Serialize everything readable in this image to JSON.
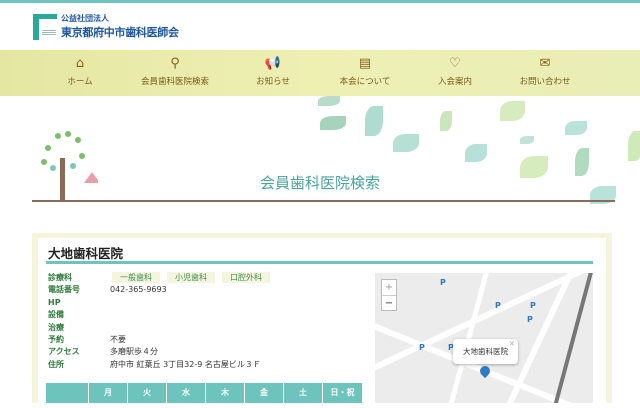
{
  "logo": {
    "sub": "公益社団法人",
    "main": "東京都府中市歯科医師会"
  },
  "nav": [
    {
      "label": "ホーム",
      "icon": "home-icon"
    },
    {
      "label": "会員歯科医院検索",
      "icon": "search-icon"
    },
    {
      "label": "お知らせ",
      "icon": "megaphone-icon"
    },
    {
      "label": "本会について",
      "icon": "clipboard-icon"
    },
    {
      "label": "入会案内",
      "icon": "heart-icon"
    },
    {
      "label": "お問い合わせ",
      "icon": "mail-icon"
    }
  ],
  "page_title": "会員歯科医院検索",
  "clinic": {
    "name": "大地歯科医院",
    "labels": {
      "dept": "診療科",
      "phone": "電話番号",
      "hp": "HP",
      "facility": "設備",
      "treatment": "治療",
      "reservation": "予約",
      "access": "アクセス",
      "address": "住所"
    },
    "departments": [
      "一般歯科",
      "小児歯科",
      "口腔外科"
    ],
    "phone": "042-365-9693",
    "reservation": "不要",
    "access": "多磨駅歩４分",
    "address": "府中市 紅葉丘 3丁目32-9 名古屋ビル３Ｆ"
  },
  "hours_header": [
    "",
    "月",
    "火",
    "水",
    "木",
    "金",
    "土",
    "日・祝"
  ],
  "map": {
    "popup": "大地歯科医院",
    "zoom_in": "+",
    "zoom_out": "−",
    "close": "×"
  }
}
